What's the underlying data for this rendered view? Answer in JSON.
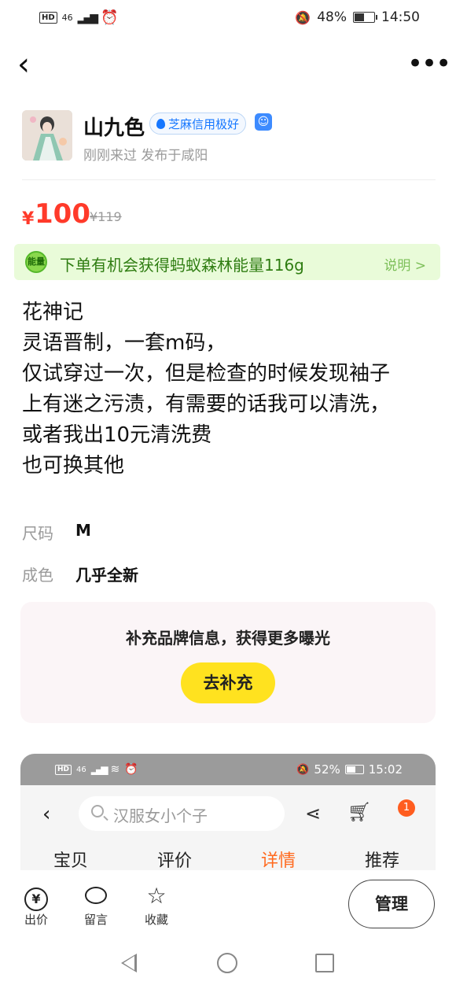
{
  "status_bar": {
    "network": "46",
    "mute_icon": "bell-off-icon",
    "battery": "48%",
    "battery_level": 0.48,
    "time": "14:50"
  },
  "seller": {
    "name": "山九色",
    "credit_badge": "芝麻信用极好",
    "meta": "刚刚来过 发布于咸阳"
  },
  "price": {
    "symbol": "¥",
    "current": "100",
    "original": "¥119"
  },
  "energy": {
    "badge": "能量",
    "text": "下单有机会获得蚂蚁森林能量116g",
    "link": "说明 >"
  },
  "description": [
    "花神记",
    "灵语晋制，一套m码，",
    "仅试穿过一次，但是检查的时候发现袖子",
    "上有迷之污渍，有需要的话我可以清洗，",
    "或者我出10元清洗费",
    "也可换其他"
  ],
  "attributes": [
    {
      "label": "尺码",
      "value": "M"
    },
    {
      "label": "成色",
      "value": "几乎全新"
    }
  ],
  "brand_prompt": {
    "text": "补充品牌信息，获得更多曝光",
    "button": "去补充"
  },
  "embedded_screenshot": {
    "status": {
      "network": "46",
      "battery": "52%",
      "battery_level": 0.52,
      "time": "15:02"
    },
    "search_placeholder": "汉服女小个子",
    "cart_badge": "1",
    "tabs": [
      "宝贝",
      "评价",
      "详情",
      "推荐"
    ],
    "active_tab": "详情",
    "active_color": "#ff6a1f"
  },
  "toolbar": {
    "items": [
      {
        "label": "出价",
        "icon": "yen-icon"
      },
      {
        "label": "留言",
        "icon": "chat-icon"
      },
      {
        "label": "收藏",
        "icon": "star-icon"
      }
    ],
    "manage_button": "管理"
  },
  "colors": {
    "price": "#ff3a2a",
    "energy_text": "#2f7d12",
    "brand_button": "#ffe21f"
  }
}
